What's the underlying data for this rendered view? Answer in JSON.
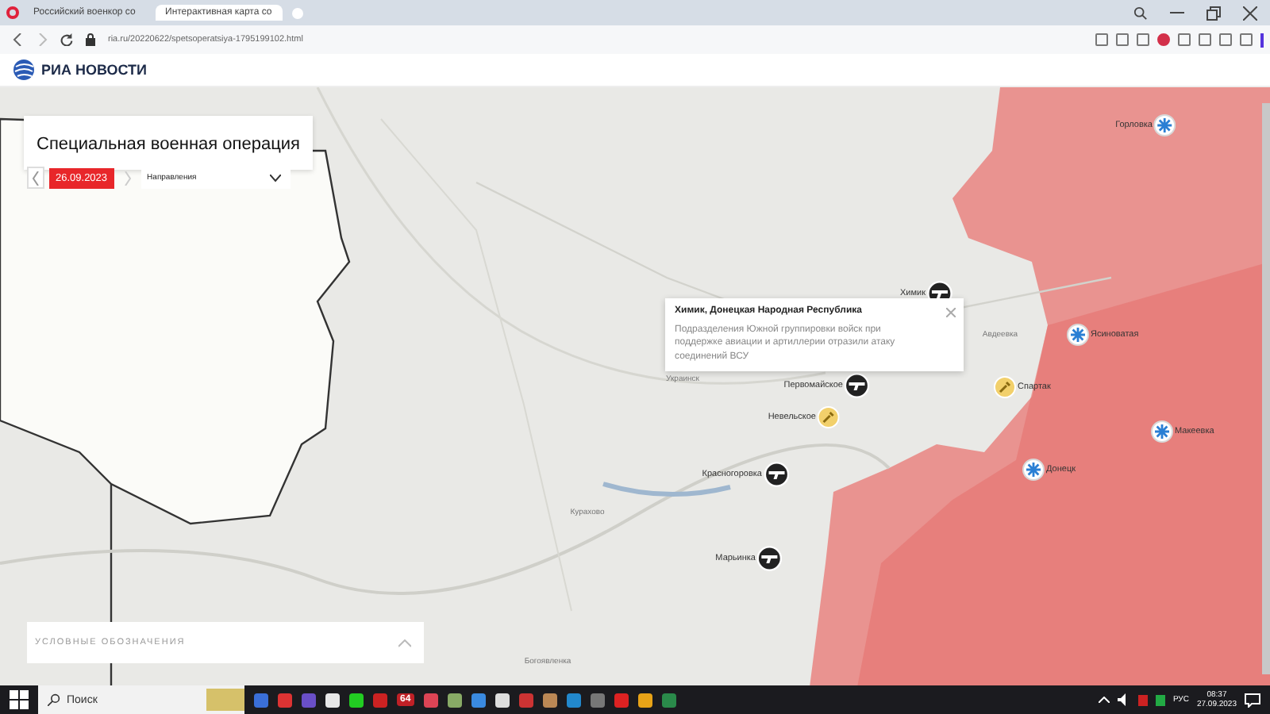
{
  "browser": {
    "tabs": [
      {
        "title": "Российский военкор со",
        "selected": false
      },
      {
        "title": "Интерактивная карта со",
        "selected": true
      }
    ],
    "url": "ria.ru/20220622/spetsoperatsiya-1795199102.html"
  },
  "site": {
    "logo": "РИА НОВОСТИ"
  },
  "panel": {
    "title": "Специальная военная операция",
    "date": "26.09.2023",
    "dropdown": "Направления"
  },
  "markers": [
    {
      "name": "Горловка",
      "kind": "city"
    },
    {
      "name": "Химик",
      "kind": "weapon"
    },
    {
      "name": "Ясиноватая",
      "kind": "city"
    },
    {
      "name": "Первомайское",
      "kind": "weapon"
    },
    {
      "name": "Спартак",
      "kind": "attack"
    },
    {
      "name": "Невельское",
      "kind": "attack"
    },
    {
      "name": "Макеевка",
      "kind": "city"
    },
    {
      "name": "Донецк",
      "kind": "city"
    },
    {
      "name": "Красногоровка",
      "kind": "weapon"
    },
    {
      "name": "Марьинка",
      "kind": "weapon"
    }
  ],
  "places": [
    "Украинск",
    "Авдеевка",
    "Курахово",
    "Богоявленка"
  ],
  "popup": {
    "title": "Химик, Донецкая Народная Республика",
    "text": "Подразделения Южной группировки войск при поддержке авиации и артиллерии отразили атаку соединений ВСУ"
  },
  "legend": {
    "title": "УСЛОВНЫЕ ОБОЗНАЧЕНИЯ",
    "expanded": false
  },
  "taskbar": {
    "search": "Поиск",
    "badge": "64",
    "language": "РУС",
    "time": "08:37",
    "date": "27.09.2023"
  }
}
